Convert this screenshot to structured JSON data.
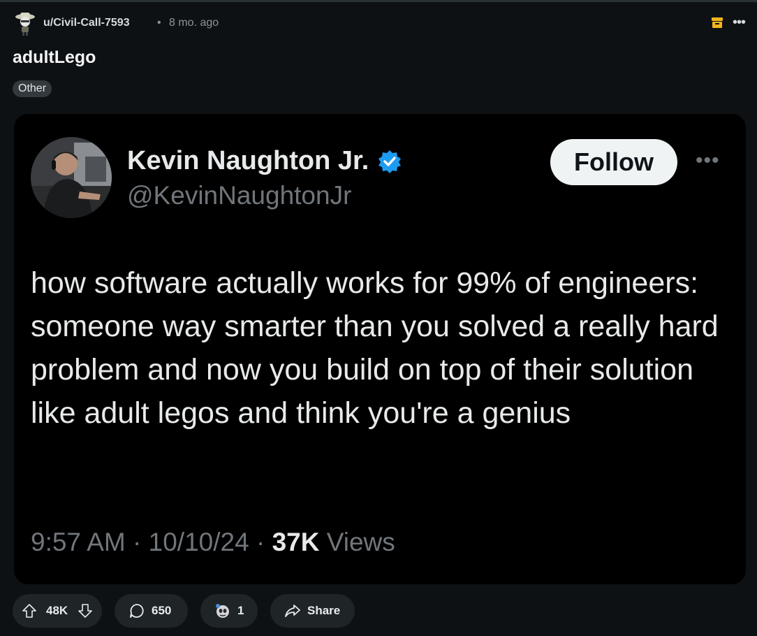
{
  "post": {
    "author": "u/Civil-Call-7593",
    "separator": "•",
    "age": "8 mo. ago",
    "title": "adultLego",
    "flair": "Other"
  },
  "tweet": {
    "name": "Kevin Naughton Jr.",
    "handle": "@KevinNaughtonJr",
    "follow_label": "Follow",
    "text": "how software actually works for 99% of engineers: someone way smarter than you solved a really hard problem and now you build on top of their solution like adult legos and think you're a genius",
    "time": "9:57 AM",
    "date": "10/10/24",
    "views_count": "37K",
    "views_label": "Views",
    "meta_sep": " · "
  },
  "actions": {
    "votes": "48K",
    "comments": "650",
    "awards": "1",
    "share": "Share"
  },
  "icons": {
    "archive": "archive-icon",
    "more": "more-options-icon",
    "verified": "verified-badge-icon",
    "upvote": "upvote-arrow-icon",
    "downvote": "downvote-arrow-icon",
    "comment": "comment-bubble-icon",
    "award": "award-icon",
    "share": "share-arrow-icon"
  },
  "colors": {
    "background": "#0e1113",
    "card": "#000000",
    "verified": "#1d9bf0",
    "archive": "#f2b51d",
    "pill": "#1f2426"
  }
}
